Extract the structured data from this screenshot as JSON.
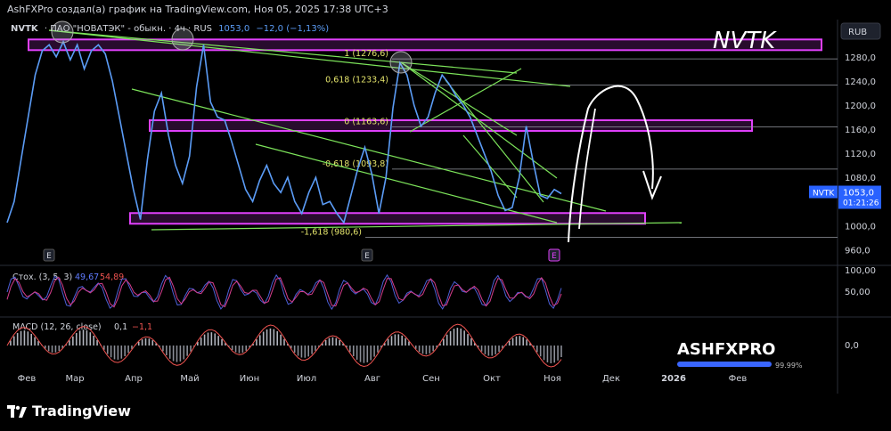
{
  "header": {
    "title": "AshFXPro создал(а) график на TradingView.com, Ноя 05, 2025 17:38 UTC+3"
  },
  "symbol_line": {
    "symbol": "NVTK",
    "desc": "· ПАО \"НОВАТЭК\" - обыкн. · 4ч · RUS",
    "price": "1053,0",
    "change": "−12,0 (−1,13%)"
  },
  "watermark": "NVTK",
  "brand": {
    "name": "ASHFXPRO",
    "progress": 0.9999,
    "progress_label": "99.99%"
  },
  "footer": {
    "name": "TradingView"
  },
  "currency_label": "RUB",
  "price_tag": {
    "symbol": "NVTK",
    "price": "1053,0",
    "timer": "01:21:26"
  },
  "colors": {
    "price": "#5b9cf6",
    "fib": "#e040fb",
    "trend": "#7ce35a",
    "stoch_k": "#4c5fd8",
    "stoch_d": "#d63d8c",
    "macd": "#ef5350",
    "drawing": "#ffffff"
  },
  "earnings_markers": [
    "E",
    "E",
    "E"
  ],
  "chart_data": {
    "type": "line",
    "title": "",
    "x_tick_labels": [
      "Фев",
      "Мар",
      "Апр",
      "Май",
      "Июн",
      "Июл",
      "Авг",
      "Сен",
      "Окт",
      "Ноя",
      "Дек",
      "2026",
      "Фев"
    ],
    "y_tick_labels": [
      "1280,0",
      "1240,0",
      "1200,0",
      "1160,0",
      "1120,0",
      "1080,0",
      "1040,0",
      "1000,0",
      "960,0"
    ],
    "ylim": [
      940,
      1330
    ],
    "series": [
      {
        "values": [
          1005,
          1040,
          1110,
          1180,
          1250,
          1290,
          1300,
          1280,
          1305,
          1275,
          1300,
          1260,
          1290,
          1300,
          1285,
          1240,
          1180,
          1120,
          1060,
          1010,
          1110,
          1190,
          1220,
          1150,
          1100,
          1070,
          1115,
          1230,
          1300,
          1205,
          1180,
          1175,
          1140,
          1100,
          1060,
          1040,
          1075,
          1100,
          1070,
          1055,
          1080,
          1040,
          1020,
          1055,
          1080,
          1035,
          1040,
          1020,
          1005,
          1050,
          1095,
          1130,
          1085,
          1020,
          1080,
          1195,
          1270,
          1250,
          1200,
          1165,
          1180,
          1220,
          1250,
          1235,
          1215,
          1200,
          1180,
          1150,
          1120,
          1090,
          1050,
          1025,
          1030,
          1080,
          1165,
          1105,
          1050,
          1045,
          1060,
          1053
        ]
      }
    ],
    "fib_levels": [
      {
        "label": "1 (1276,6)",
        "value": 1276.6
      },
      {
        "label": "0,618 (1233,4)",
        "value": 1233.4
      },
      {
        "label": "0 (1163,6)",
        "value": 1163.6
      },
      {
        "label": "-0,618 (1093,8)",
        "value": 1093.8
      },
      {
        "label": "-1,618 (980,6)",
        "value": 980.6
      }
    ],
    "zones": [
      1300,
      1166,
      1012
    ],
    "stochastic": {
      "label": "Стох. (3, 5, 3)",
      "k": "49,67",
      "d": "54,89",
      "ticks": [
        "100,00",
        "50,00"
      ]
    },
    "macd": {
      "label": "MACD (12, 26, close)",
      "value1": "0,1",
      "value2": "−1,1",
      "ticks": [
        "0,0"
      ]
    }
  }
}
